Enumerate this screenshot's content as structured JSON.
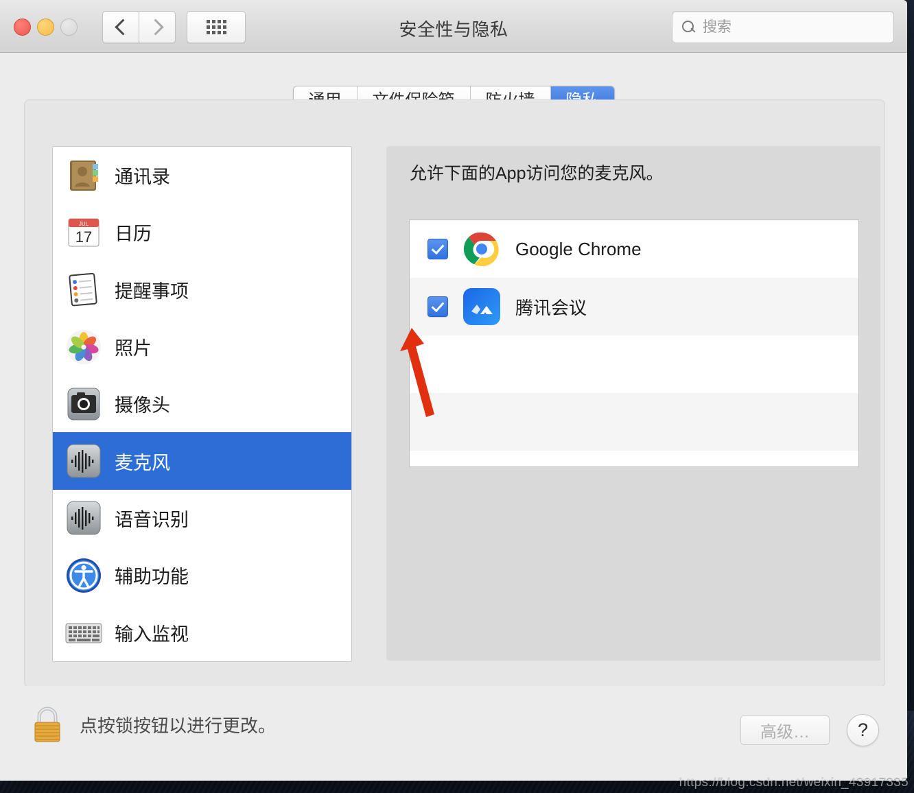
{
  "window": {
    "title": "安全性与隐私",
    "traffic_lights": [
      "close-red",
      "minimize-yellow",
      "zoom-gray-disabled"
    ],
    "nav": {
      "back": "back-chevron",
      "forward": "forward-chevron",
      "show_all": "grid-icon"
    },
    "search": {
      "placeholder": "搜索",
      "value": ""
    }
  },
  "tabs": [
    {
      "label": "通用",
      "active": false
    },
    {
      "label": "文件保险箱",
      "active": false
    },
    {
      "label": "防火墙",
      "active": false
    },
    {
      "label": "隐私",
      "active": true
    }
  ],
  "sidebar": {
    "items": [
      {
        "label": "通讯录",
        "icon": "contacts-icon",
        "selected": false
      },
      {
        "label": "日历",
        "icon": "calendar-icon",
        "selected": false
      },
      {
        "label": "提醒事项",
        "icon": "reminders-icon",
        "selected": false
      },
      {
        "label": "照片",
        "icon": "photos-icon",
        "selected": false
      },
      {
        "label": "摄像头",
        "icon": "camera-icon",
        "selected": false
      },
      {
        "label": "麦克风",
        "icon": "microphone-icon",
        "selected": true
      },
      {
        "label": "语音识别",
        "icon": "speech-recognition-icon",
        "selected": false
      },
      {
        "label": "辅助功能",
        "icon": "accessibility-icon",
        "selected": false
      },
      {
        "label": "输入监视",
        "icon": "input-monitoring-icon",
        "selected": false
      }
    ]
  },
  "main": {
    "heading": "允许下面的App访问您的麦克风。",
    "apps": [
      {
        "name": "Google Chrome",
        "icon": "chrome-icon",
        "checked": true
      },
      {
        "name": "腾讯会议",
        "icon": "tencent-meeting-icon",
        "checked": true
      }
    ],
    "empty_rows": 3
  },
  "footer": {
    "lock_text": "点按锁按钮以进行更改。",
    "lock_icon": "padlock-closed-icon",
    "advanced_label": "高级…",
    "advanced_disabled": true,
    "help_label": "?"
  },
  "watermark": "https://blog.csdn.net/weixin_43917335",
  "colors": {
    "accent_blue": "#2c6ed5",
    "tab_active_blue": "#2e6dd6",
    "checkbox_blue": "#2f73e0",
    "annotation_red": "#e03010",
    "window_bg": "#ececec",
    "panel_bg": "#e6e6e6",
    "right_panel_bg": "#d9d9d9",
    "row_alt_bg": "#f5f5f5"
  }
}
